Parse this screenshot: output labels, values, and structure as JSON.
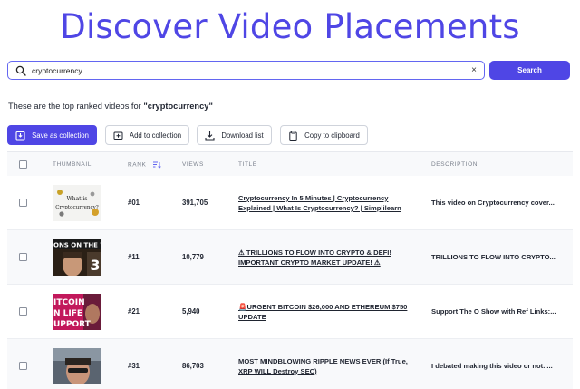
{
  "page": {
    "title": "Discover Video Placements"
  },
  "search": {
    "value": "cryptocurrency",
    "clear_label": "×",
    "button_label": "Search"
  },
  "results": {
    "prefix": "These are the top ranked videos for ",
    "query_quoted": "\"cryptocurrency\""
  },
  "toolbar": {
    "save_label": "Save as collection",
    "add_label": "Add to collection",
    "download_label": "Download list",
    "copy_label": "Copy to clipboard"
  },
  "table": {
    "headers": {
      "thumbnail": "THUMBNAIL",
      "rank": "RANK",
      "views": "VIEWS",
      "title": "TITLE",
      "description": "DESCRIPTION"
    },
    "rows": [
      {
        "rank": "#01",
        "views": "391,705",
        "title": "Cryptocurrency In 5 Minutes | Cryptocurrency Explained | What Is Cryptocurrency? | Simplilearn",
        "description": "This video on Cryptocurrency cover...",
        "thumb_text": [
          "What is",
          "Cryptocurrency?"
        ]
      },
      {
        "rank": "#11",
        "views": "10,779",
        "title": "⚠ TRILLIONS TO FLOW INTO CRYPTO & DEFI! IMPORTANT CRYPTO MARKET UPDATE! ⚠",
        "description": "TRILLIONS TO FLOW INTO CRYPTO...",
        "thumb_text": [
          "LIONS ON THE W",
          "3"
        ]
      },
      {
        "rank": "#21",
        "views": "5,940",
        "title": "🚨URGENT BITCOIN $26,000 AND ETHEREUM $750 UPDATE",
        "description": "Support The O Show with Ref Links:...",
        "thumb_text": [
          "ITCOIN",
          "N LIFE",
          "UPPORT"
        ]
      },
      {
        "rank": "#31",
        "views": "86,703",
        "title": "MOST MINDBLOWING RIPPLE NEWS EVER (If True, XRP WILL Destroy SEC)",
        "description": "I debated making this video or not. ...",
        "thumb_text": []
      }
    ]
  },
  "colors": {
    "accent": "#4f46e5",
    "border": "#cfd3db"
  }
}
